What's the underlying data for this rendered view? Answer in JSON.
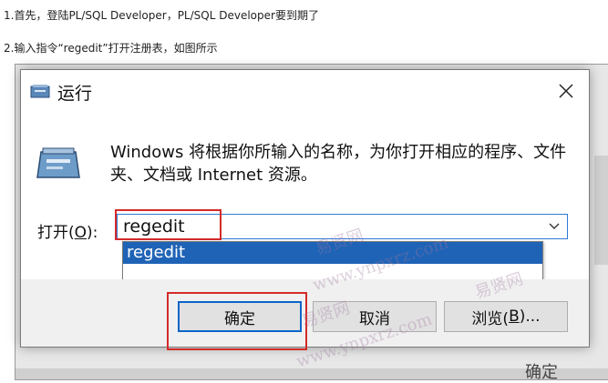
{
  "document": {
    "line1": "1.首先，登陆PL/SQL Developer，PL/SQL Developer要到期了",
    "line2": "2.输入指令“regedit”打开注册表，如图所示"
  },
  "background": {
    "bottom_text": "确定"
  },
  "dialog": {
    "title": "运行",
    "description": "Windows 将根据你所输入的名称，为你打开相应的程序、文件夹、文档或 Internet 资源。",
    "open_label": "打开(",
    "open_label_key": "O",
    "open_label_end": "):",
    "input_value": "regedit",
    "dropdown_items": [
      "regedit"
    ],
    "buttons": {
      "ok": "确定",
      "cancel": "取消",
      "browse": "浏览(",
      "browse_key": "B",
      "browse_end": ")..."
    }
  },
  "watermark": {
    "brand": "易贤网",
    "domain": "www.ynpxrz.com"
  },
  "colors": {
    "highlight_red": "#d42a2a",
    "selection_blue": "#1f63b6",
    "focus_blue": "#2f7ad6"
  }
}
